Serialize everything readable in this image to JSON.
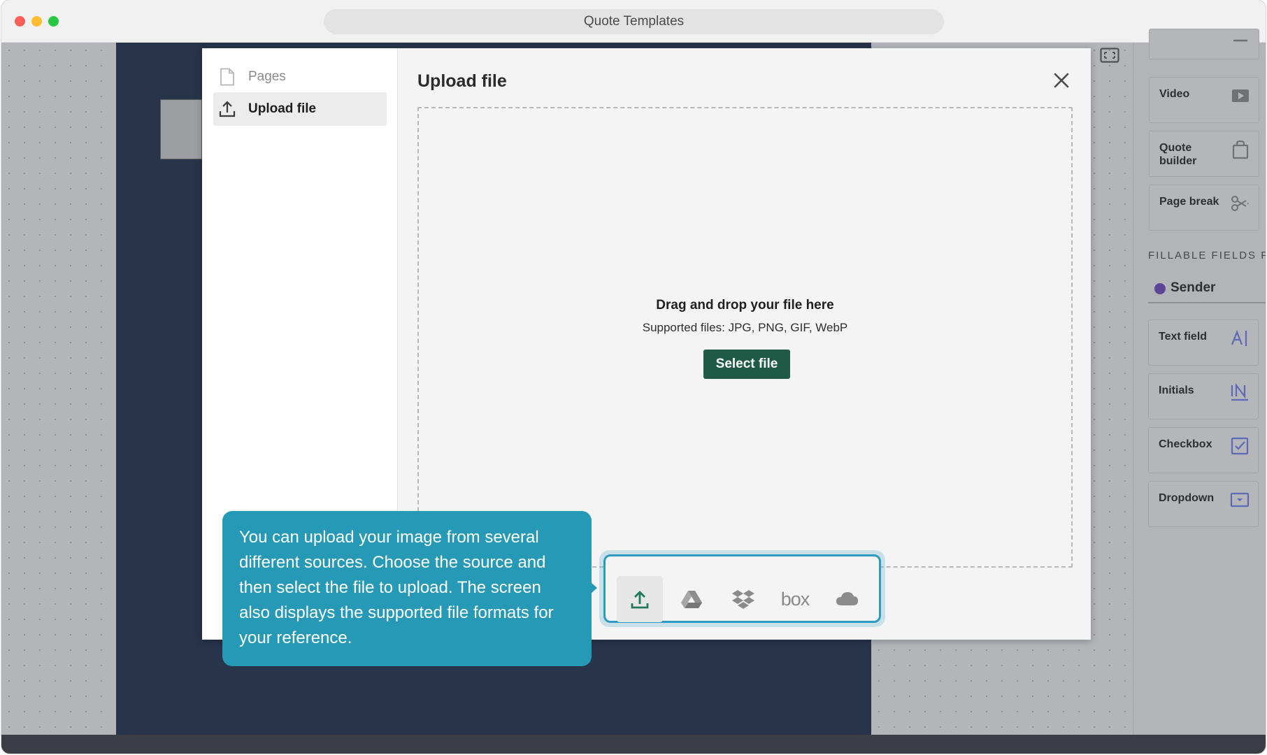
{
  "window": {
    "title": "Quote Templates"
  },
  "side_panel": {
    "items_top": [
      {
        "label": "Video",
        "icon": "video-play-icon"
      },
      {
        "label": "Quote builder",
        "icon": "shopping-bag-icon"
      },
      {
        "label": "Page break",
        "icon": "scissors-icon"
      }
    ],
    "fillable_heading": "FILLABLE FIELDS F",
    "sender_label": "Sender",
    "fields": [
      {
        "label": "Text field",
        "icon": "text-cursor-icon"
      },
      {
        "label": "Initials",
        "icon": "initials-icon"
      },
      {
        "label": "Checkbox",
        "icon": "checkbox-icon"
      },
      {
        "label": "Dropdown",
        "icon": "dropdown-icon"
      }
    ]
  },
  "modal": {
    "title": "Upload file",
    "nav": [
      {
        "label": "Pages",
        "icon": "page-icon",
        "active": false
      },
      {
        "label": "Upload file",
        "icon": "upload-icon",
        "active": true
      }
    ],
    "dropzone": {
      "title": "Drag and drop your file here",
      "supported": "Supported files: JPG, PNG, GIF, WebP",
      "button_label": "Select file"
    },
    "sources": [
      {
        "name": "upload-from-computer",
        "icon": "upload-icon",
        "active": true
      },
      {
        "name": "google-drive",
        "icon": "google-drive-icon",
        "active": false
      },
      {
        "name": "dropbox",
        "icon": "dropbox-icon",
        "active": false
      },
      {
        "name": "box",
        "icon": "box-icon",
        "label": "box",
        "active": false
      },
      {
        "name": "onedrive",
        "icon": "cloud-icon",
        "active": false
      }
    ]
  },
  "tooltip": {
    "text": "You can upload your image from several different sources. Choose the source and then select the file to upload. The screen also displays the supported file formats for your reference."
  },
  "colors": {
    "accent_green": "#1e5a45",
    "tooltip_blue": "#2699b6",
    "sender_purple": "#5b4598",
    "doc_navy": "#27344a"
  }
}
